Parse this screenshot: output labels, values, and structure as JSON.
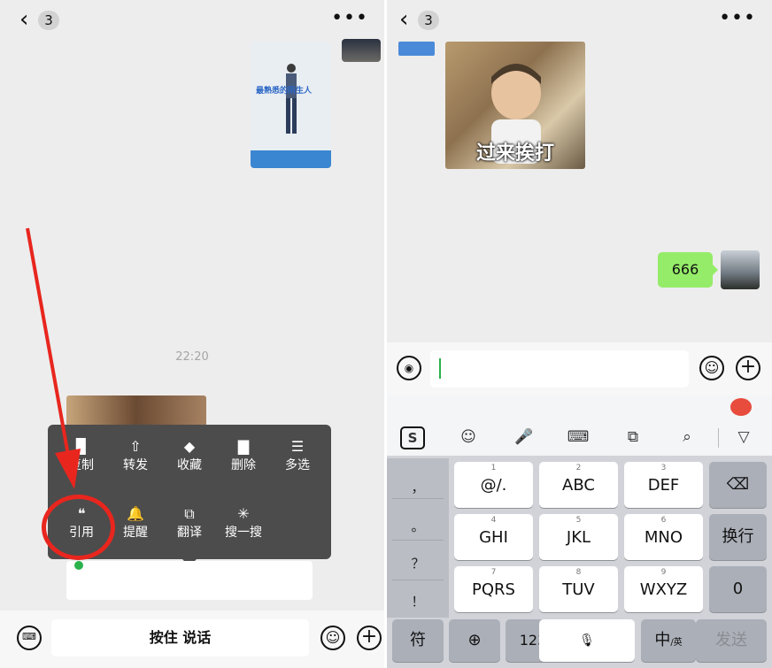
{
  "left": {
    "topbar": {
      "back": "‹",
      "badge": "3",
      "more": "•••"
    },
    "poster_text": "最熟悉的陌生人",
    "timestamp": "22:20",
    "menu": {
      "row1": [
        "复制",
        "转发",
        "收藏",
        "删除",
        "多选"
      ],
      "row2": [
        "引用",
        "提醒",
        "翻译",
        "搜一搜"
      ]
    },
    "bottombar": {
      "hold_to_talk": "按住 说话"
    }
  },
  "right": {
    "topbar": {
      "back": "‹",
      "badge": "3",
      "more": "•••"
    },
    "sticker_caption": "过来挨打",
    "sent_message": "666",
    "keyboard": {
      "symbols": [
        "，",
        "。",
        "？",
        "！"
      ],
      "keys": [
        {
          "num": "1",
          "label": "@/."
        },
        {
          "num": "2",
          "label": "ABC"
        },
        {
          "num": "3",
          "label": "DEF"
        },
        {
          "num": "4",
          "label": "GHI"
        },
        {
          "num": "5",
          "label": "JKL"
        },
        {
          "num": "6",
          "label": "MNO"
        },
        {
          "num": "7",
          "label": "PQRS"
        },
        {
          "num": "8",
          "label": "TUV"
        },
        {
          "num": "9",
          "label": "WXYZ"
        }
      ],
      "backspace": "⌫",
      "newline": "换行",
      "zero": "0",
      "fu": "符",
      "globe": "⊕",
      "num123": "123",
      "mic": "🎙",
      "zhong": "中",
      "zhong_sub": "/英",
      "send": "发送"
    }
  }
}
